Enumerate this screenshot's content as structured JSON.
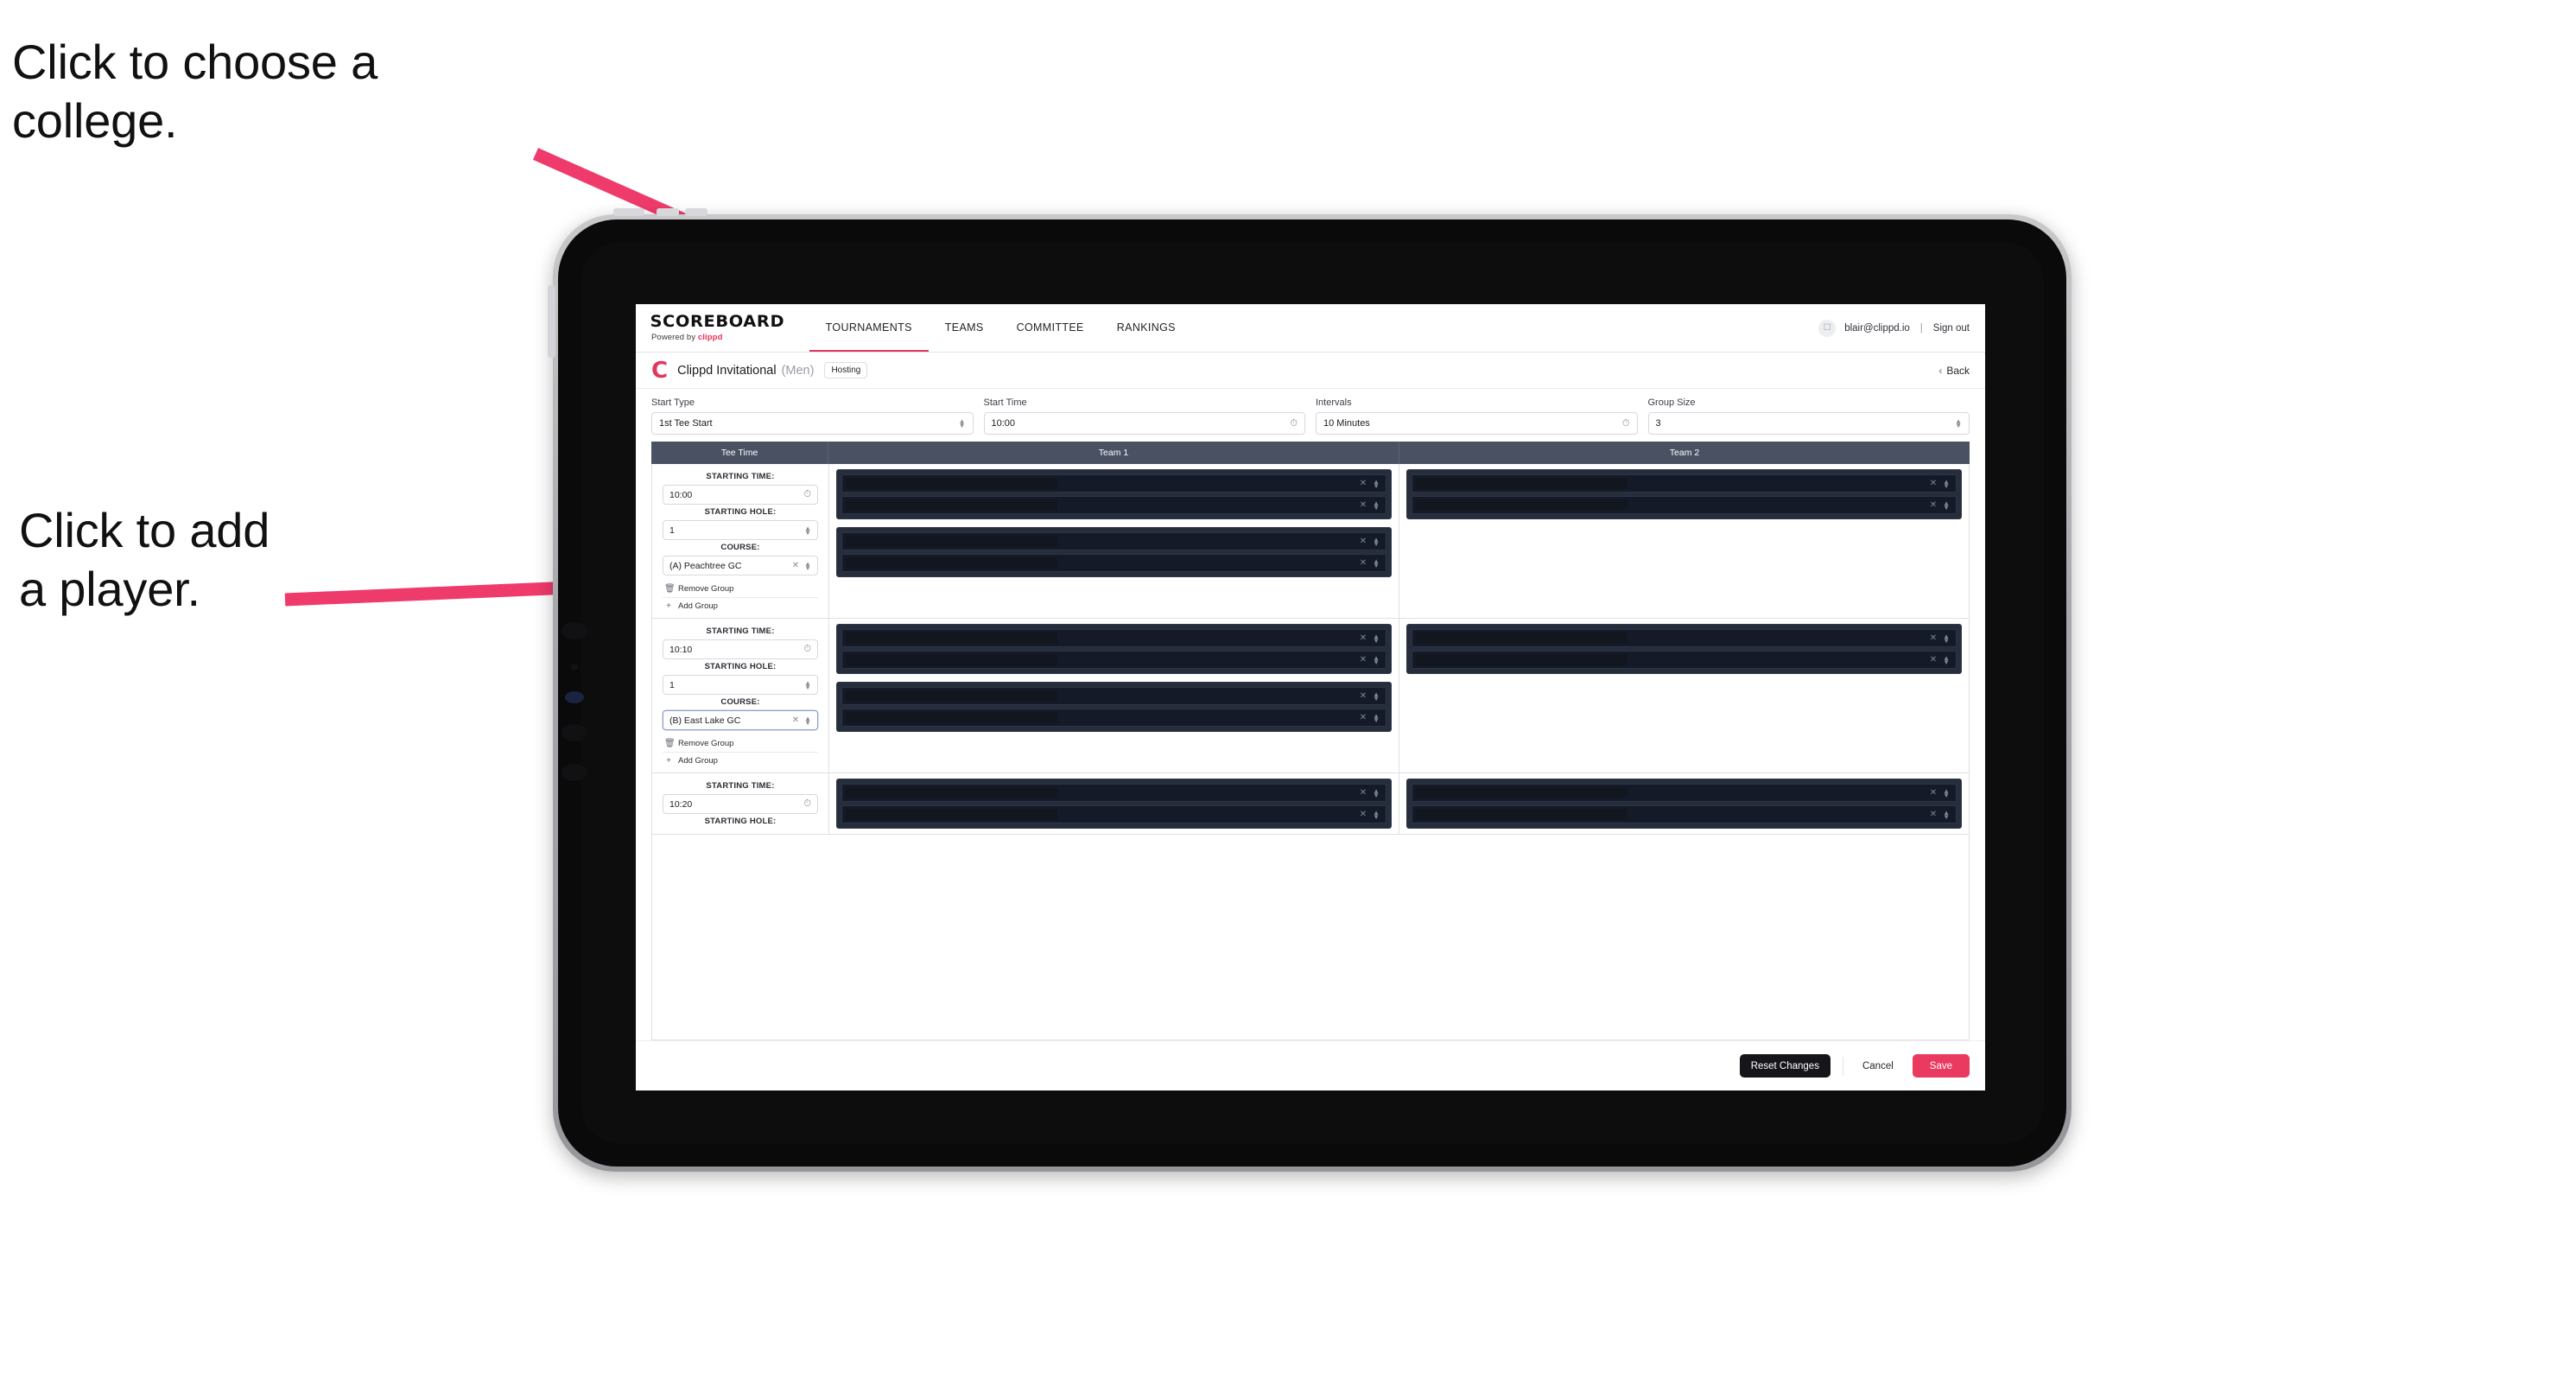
{
  "annotations": {
    "college": "Click to choose a\ncollege.",
    "player": "Click to add\na player."
  },
  "accent_colors": {
    "brand_pink": "#e0385c",
    "arrow_pink": "#ef3b6b",
    "save_red": "#ea3a5f",
    "table_header": "#4a5163",
    "player_card": "#262d3b",
    "player_row": "#141a27"
  },
  "topbar": {
    "brand_word": "SCOREBOARD",
    "brand_sub_prefix": "Powered by ",
    "brand_sub_name": "clippd",
    "nav": [
      {
        "label": "TOURNAMENTS",
        "active": true
      },
      {
        "label": "TEAMS",
        "active": false
      },
      {
        "label": "COMMITTEE",
        "active": false
      },
      {
        "label": "RANKINGS",
        "active": false
      }
    ],
    "avatar_icon": "user-avatar-icon",
    "account_email": "blair@clippd.io",
    "separator": "|",
    "sign_out": "Sign out"
  },
  "subheader": {
    "logo_letter": "C",
    "tournament_name": "Clippd Invitational",
    "gender": "(Men)",
    "badge": "Hosting",
    "back_chevron": "‹",
    "back_label": "Back"
  },
  "controls": [
    {
      "label": "Start Type",
      "value": "1st Tee Start",
      "icon": "stepper-icon"
    },
    {
      "label": "Start Time",
      "value": "10:00",
      "icon": "clock-icon"
    },
    {
      "label": "Intervals",
      "value": "10 Minutes",
      "icon": "clock-icon"
    },
    {
      "label": "Group Size",
      "value": "3",
      "icon": "stepper-icon"
    }
  ],
  "table": {
    "headers": [
      "Tee Time",
      "Team 1",
      "Team 2"
    ],
    "labels": {
      "starting_time": "STARTING TIME:",
      "starting_hole": "STARTING HOLE:",
      "course": "COURSE:",
      "remove_group": "Remove Group",
      "add_group": "Add Group"
    },
    "groups": [
      {
        "starting_time": "10:00",
        "starting_hole": "1",
        "course": "(A) Peachtree GC",
        "course_focused": false,
        "team1_cards": [
          {
            "rows": [
              {
                "name": ""
              },
              {
                "name": ""
              }
            ]
          },
          {
            "rows": [
              {
                "name": ""
              },
              {
                "name": ""
              }
            ]
          }
        ],
        "team2_cards": [
          {
            "rows": [
              {
                "name": ""
              },
              {
                "name": ""
              }
            ]
          }
        ]
      },
      {
        "starting_time": "10:10",
        "starting_hole": "1",
        "course": "(B) East Lake GC",
        "course_focused": true,
        "team1_cards": [
          {
            "rows": [
              {
                "name": ""
              },
              {
                "name": ""
              }
            ]
          },
          {
            "rows": [
              {
                "name": ""
              },
              {
                "name": ""
              }
            ]
          }
        ],
        "team2_cards": [
          {
            "rows": [
              {
                "name": ""
              },
              {
                "name": ""
              }
            ]
          }
        ]
      },
      {
        "starting_time": "10:20",
        "starting_hole": "",
        "course": "",
        "course_focused": false,
        "partial": true,
        "team1_cards": [
          {
            "rows": [
              {
                "name": ""
              },
              {
                "name": ""
              }
            ]
          }
        ],
        "team2_cards": [
          {
            "rows": [
              {
                "name": ""
              },
              {
                "name": ""
              }
            ]
          }
        ]
      }
    ]
  },
  "footer": {
    "reset": "Reset Changes",
    "cancel": "Cancel",
    "save": "Save"
  }
}
